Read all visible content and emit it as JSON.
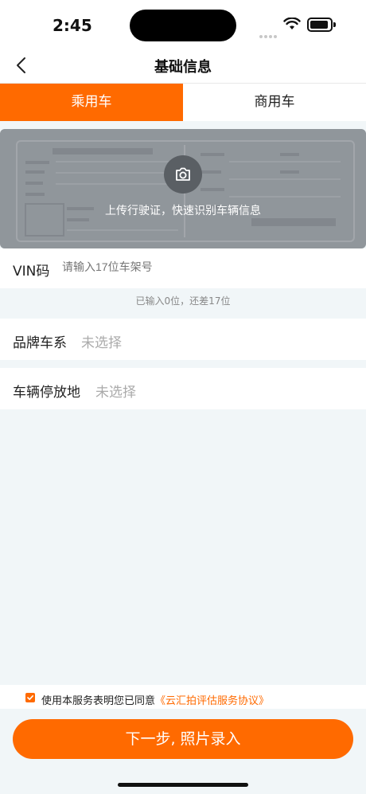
{
  "status_bar": {
    "time": "2:45"
  },
  "nav": {
    "title": "基础信息",
    "back_icon": "chevron-left-icon"
  },
  "tabs": [
    {
      "label": "乘用车",
      "active": true
    },
    {
      "label": "商用车",
      "active": false
    }
  ],
  "upload": {
    "icon": "camera-icon",
    "text": "上传行驶证，快速识别车辆信息"
  },
  "vin": {
    "label": "VIN码",
    "placeholder": "请输入17位车架号",
    "value": "",
    "hint": "已输入0位，还差17位"
  },
  "brand": {
    "label": "品牌车系",
    "value": "未选择"
  },
  "parking": {
    "label": "车辆停放地",
    "value": "未选择"
  },
  "agreement": {
    "checked": true,
    "text": "使用本服务表明您已同意",
    "link": "《云汇拍评估服务协议》"
  },
  "primary_button": {
    "label": "下一步, 照片录入"
  },
  "colors": {
    "accent": "#ff6a00",
    "background": "#f1f6f8"
  }
}
